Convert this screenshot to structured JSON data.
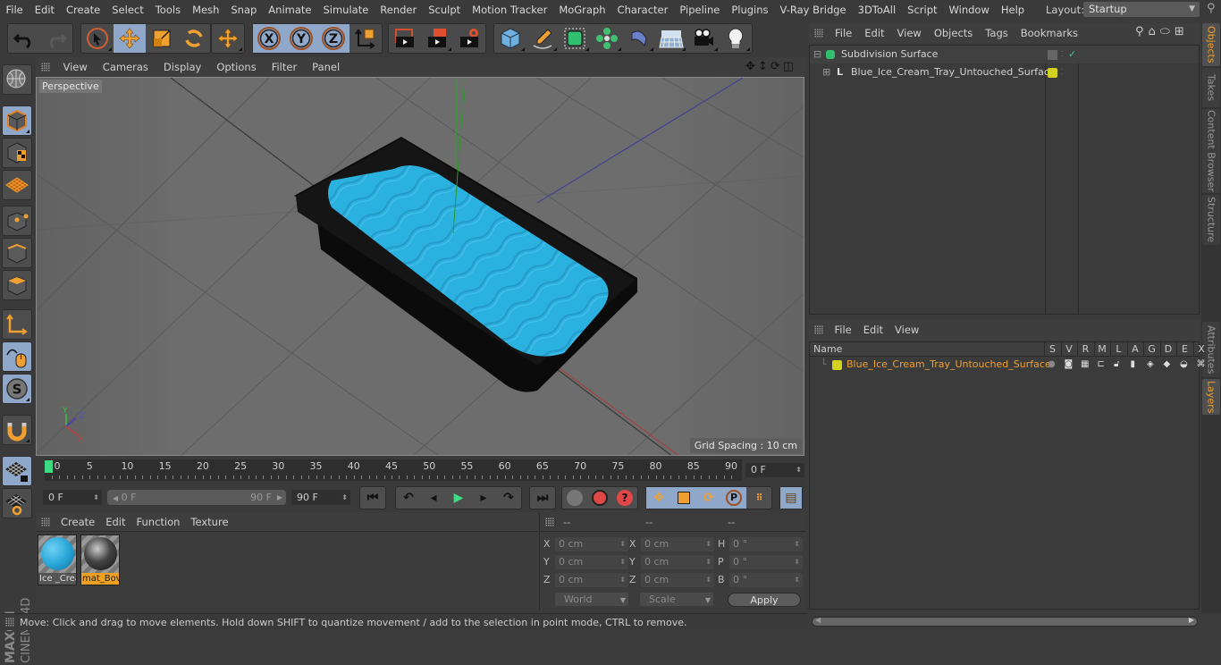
{
  "menu": [
    "File",
    "Edit",
    "Create",
    "Select",
    "Tools",
    "Mesh",
    "Snap",
    "Animate",
    "Simulate",
    "Render",
    "Sculpt",
    "Motion Tracker",
    "MoGraph",
    "Character",
    "Pipeline",
    "Plugins",
    "V-Ray Bridge",
    "3DToAll",
    "Script",
    "Window",
    "Help"
  ],
  "layout": {
    "label": "Layout:",
    "value": "Startup"
  },
  "toolbar": {
    "undo": "undo-icon",
    "redo": "redo-icon",
    "axis_x": "X",
    "axis_y": "Y",
    "axis_z": "Z"
  },
  "viewport": {
    "menu": [
      "View",
      "Cameras",
      "Display",
      "Options",
      "Filter",
      "Panel"
    ],
    "camera_label": "Perspective",
    "grid_spacing": "Grid Spacing : 10 cm",
    "axis_labels": {
      "x": "X",
      "y": "Y",
      "z": "Z"
    }
  },
  "timeline": {
    "ticks": [
      "0",
      "5",
      "10",
      "15",
      "20",
      "25",
      "30",
      "35",
      "40",
      "45",
      "50",
      "55",
      "60",
      "65",
      "70",
      "75",
      "80",
      "85",
      "90"
    ],
    "current_frame": "0 F"
  },
  "transport": {
    "start_field": "0 F",
    "range_start": "0 F",
    "range_end": "90 F",
    "end_field": "90 F"
  },
  "materials": {
    "menu": [
      "Create",
      "Edit",
      "Function",
      "Texture"
    ],
    "items": [
      {
        "name": "Ice _Crea",
        "color": "#2aa8d8",
        "selected": false
      },
      {
        "name": "mat_Bov",
        "color": "#333333",
        "selected": true
      }
    ]
  },
  "coordinates": {
    "headers": [
      "--",
      "--",
      "--"
    ],
    "rows": [
      {
        "l1": "X",
        "v1": "0 cm",
        "l2": "X",
        "v2": "0 cm",
        "l3": "H",
        "v3": "0 °"
      },
      {
        "l1": "Y",
        "v1": "0 cm",
        "l2": "Y",
        "v2": "0 cm",
        "l3": "P",
        "v3": "0 °"
      },
      {
        "l1": "Z",
        "v1": "0 cm",
        "l2": "Z",
        "v2": "0 cm",
        "l3": "B",
        "v3": "0 °"
      }
    ],
    "mode": "World",
    "type": "Scale",
    "apply": "Apply"
  },
  "status": "Move: Click and drag to move elements. Hold down SHIFT to quantize movement / add to the selection in point mode, CTRL to remove.",
  "objects": {
    "menu": [
      "File",
      "Edit",
      "View",
      "Objects",
      "Tags",
      "Bookmarks"
    ],
    "items": [
      {
        "name": "Subdivision Surface",
        "check": "✓"
      },
      {
        "name": "Blue_Ice_Cream_Tray_Untouched_Surface",
        "layer_color": "#d4d020"
      }
    ]
  },
  "side_tabs_top": [
    "Objects",
    "Takes",
    "Content Browser",
    "Structure"
  ],
  "side_tabs_bottom": [
    "Attributes",
    "Layers"
  ],
  "layers": {
    "menu": [
      "File",
      "Edit",
      "View"
    ],
    "columns": [
      "Name",
      "S",
      "V",
      "R",
      "M",
      "L",
      "A",
      "G",
      "D",
      "E",
      "X"
    ],
    "items": [
      {
        "name": "Blue_Ice_Cream_Tray_Untouched_Surface",
        "color": "#d4d020"
      }
    ]
  },
  "branding": {
    "maxon": "MAXON",
    "product": "CINEMA 4D"
  }
}
